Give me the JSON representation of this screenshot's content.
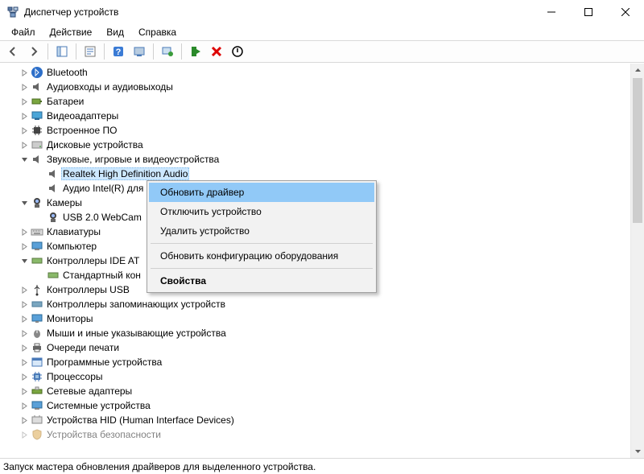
{
  "window": {
    "title": "Диспетчер устройств"
  },
  "menu": {
    "file": "Файл",
    "action": "Действие",
    "view": "Вид",
    "help": "Справка"
  },
  "status": {
    "text": "Запуск мастера обновления драйверов для выделенного устройства."
  },
  "tree": {
    "bluetooth": "Bluetooth",
    "audio_io": "Аудиовходы и аудиовыходы",
    "batteries": "Батареи",
    "video_adapters": "Видеоадаптеры",
    "firmware": "Встроенное ПО",
    "disk": "Дисковые устройства",
    "sound": "Звуковые, игровые и видеоустройства",
    "sound_realtek": "Realtek High Definition Audio",
    "sound_intel": "Аудио Intel(R) для",
    "cameras": "Камеры",
    "camera_usb": "USB 2.0 WebCam",
    "keyboards": "Клавиатуры",
    "computer": "Компьютер",
    "ide": "Контроллеры IDE AT",
    "ide_std": "Стандартный кон",
    "usb": "Контроллеры USB",
    "storage": "Контроллеры запоминающих устройств",
    "monitors": "Мониторы",
    "mice": "Мыши и иные указывающие устройства",
    "print_queues": "Очереди печати",
    "software_devices": "Программные устройства",
    "processors": "Процессоры",
    "network": "Сетевые адаптеры",
    "system": "Системные устройства",
    "hid": "Устройства HID (Human Interface Devices)",
    "security": "Устройства безопасности"
  },
  "context_menu": {
    "update_driver": "Обновить драйвер",
    "disable": "Отключить устройство",
    "uninstall": "Удалить устройство",
    "scan": "Обновить конфигурацию оборудования",
    "properties": "Свойства"
  }
}
